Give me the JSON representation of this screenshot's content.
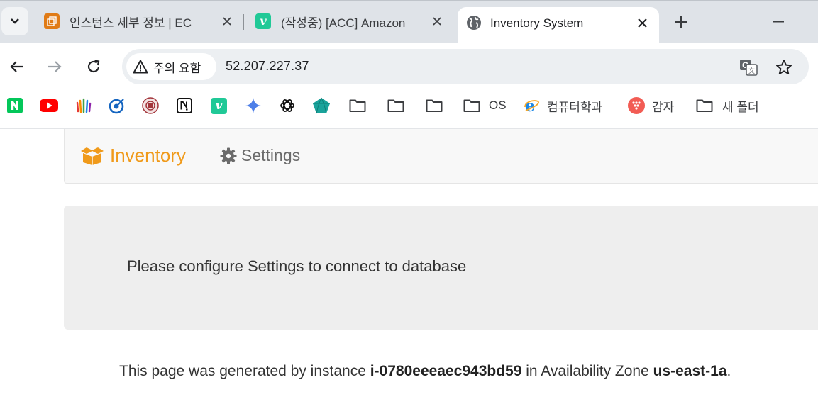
{
  "browser": {
    "tabs": [
      {
        "title": "인스턴스 세부 정보 | EC",
        "favicon": "aws-ec2-icon",
        "active": false
      },
      {
        "title": "(작성중) [ACC] Amazon",
        "favicon": "velog-icon",
        "active": false
      },
      {
        "title": "Inventory System",
        "favicon": "globe-icon",
        "active": true
      }
    ],
    "security_label": "주의 요함",
    "url": "52.207.227.37",
    "bookmarks": [
      {
        "icon": "naver-icon",
        "label": ""
      },
      {
        "icon": "youtube-icon",
        "label": ""
      },
      {
        "icon": "hands-icon",
        "label": ""
      },
      {
        "icon": "target-icon",
        "label": ""
      },
      {
        "icon": "university-seal-icon",
        "label": ""
      },
      {
        "icon": "notion-icon",
        "label": ""
      },
      {
        "icon": "velog-icon",
        "label": ""
      },
      {
        "icon": "gemini-icon",
        "label": ""
      },
      {
        "icon": "chatgpt-icon",
        "label": ""
      },
      {
        "icon": "gem-icon",
        "label": ""
      },
      {
        "icon": "folder-icon",
        "label": ""
      },
      {
        "icon": "folder-icon",
        "label": ""
      },
      {
        "icon": "folder-icon",
        "label": ""
      },
      {
        "icon": "folder-icon",
        "label": "OS"
      },
      {
        "icon": "ie-icon",
        "label": "컴퓨터학과"
      },
      {
        "icon": "dots-icon",
        "label": "감자"
      },
      {
        "icon": "folder-icon",
        "label": "새 폴더"
      }
    ]
  },
  "page": {
    "brand": "Inventory",
    "settings": "Settings",
    "message": "Please configure Settings to connect to database",
    "footer": {
      "prefix": "This page was generated by instance ",
      "instance_id": "i-0780eeeaec943bd59",
      "middle": " in Availability Zone ",
      "zone": "us-east-1a",
      "suffix": "."
    }
  },
  "colors": {
    "brand": "#f09a1a",
    "tabstrip": "#dfe3e8",
    "omnibox": "#eceff2",
    "jumbotron": "#eeeeee"
  }
}
